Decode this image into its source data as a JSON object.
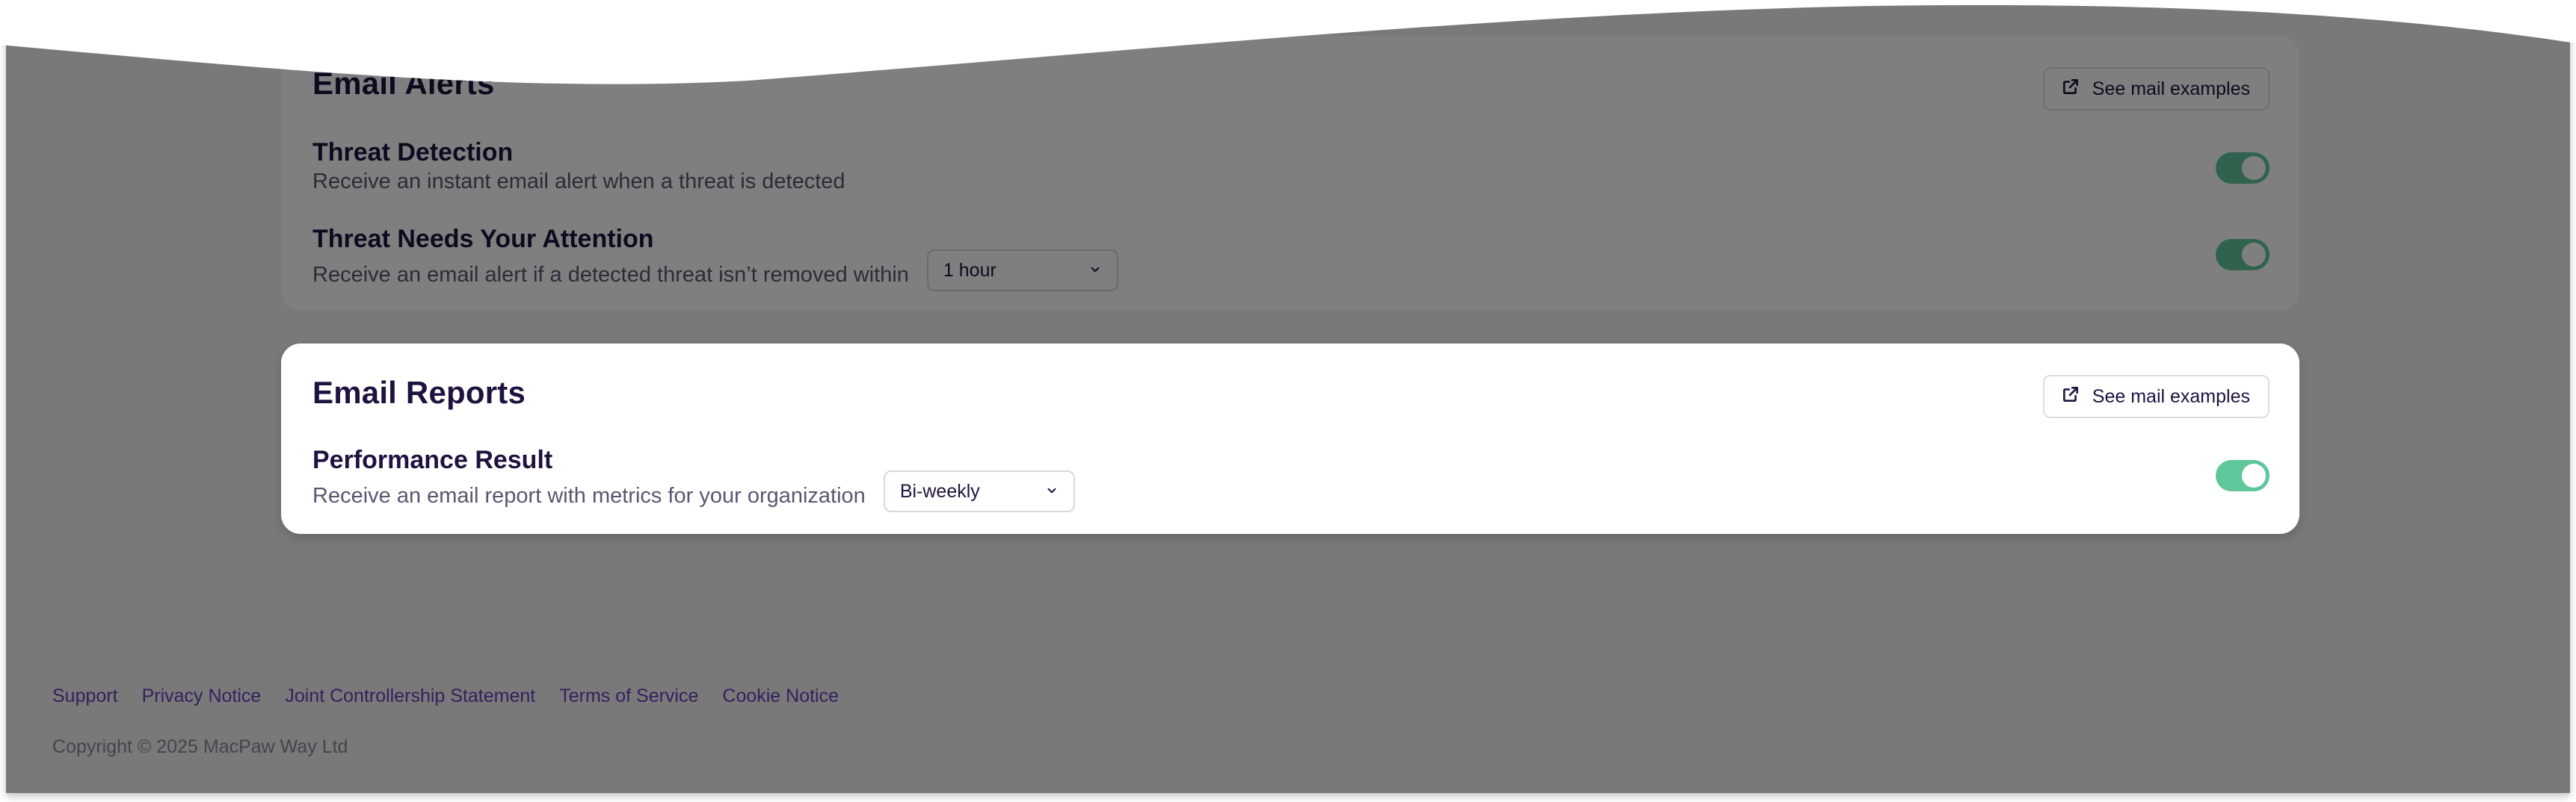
{
  "email_alerts": {
    "title": "Email Alerts",
    "examples_label": "See mail examples",
    "rows": [
      {
        "title": "Threat Detection",
        "description": "Receive an instant email alert when a threat is detected",
        "enabled": true
      },
      {
        "title": "Threat Needs Your Attention",
        "description": "Receive an email alert if a detected threat isn’t removed within",
        "select_value": "1 hour",
        "enabled": true
      }
    ]
  },
  "email_reports": {
    "title": "Email Reports",
    "examples_label": "See mail examples",
    "rows": [
      {
        "title": "Performance Result",
        "description": "Receive an email report with metrics for your organization",
        "select_value": "Bi-weekly",
        "enabled": true
      }
    ]
  },
  "footer": {
    "links": [
      "Support",
      "Privacy Notice",
      "Joint Controllership Statement",
      "Terms of Service",
      "Cookie Notice"
    ],
    "copyright": "Copyright © 2025 MacPaw Way Ltd"
  },
  "colors": {
    "accent_toggle": "#5fc79a",
    "footer_link": "#6d3fb8",
    "heading": "#1f1240",
    "overlay": "rgba(0,0,0,0.5)"
  },
  "icons": {
    "external_link": "external-link-icon",
    "chevron": "chevron-down-icon"
  }
}
